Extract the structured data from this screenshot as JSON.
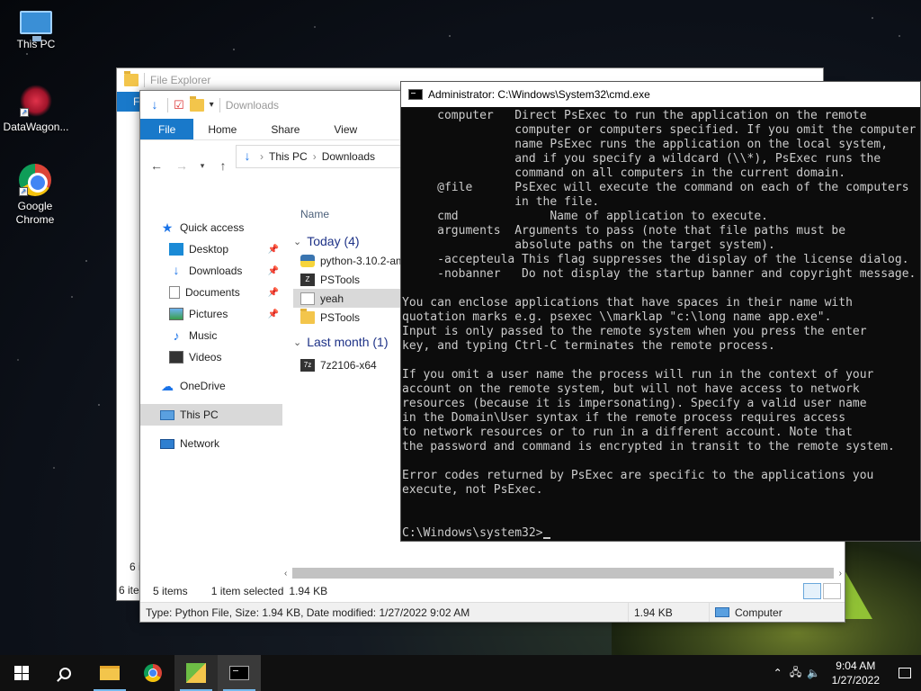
{
  "desktop": {
    "icons": [
      {
        "label": "This PC"
      },
      {
        "label": "DataWagon..."
      },
      {
        "label": "Google Chrome"
      }
    ]
  },
  "back_explorer": {
    "title": "File Explorer",
    "file_tab": "F",
    "status_a": "6 i",
    "status_b": "6 ite"
  },
  "explorer": {
    "title": "Downloads",
    "ribbon_tabs": [
      "File",
      "Home",
      "Share",
      "View"
    ],
    "breadcrumb": [
      "This PC",
      "Downloads"
    ],
    "nav_items": [
      {
        "label": "Quick access",
        "pinned": false
      },
      {
        "label": "Desktop",
        "pinned": true
      },
      {
        "label": "Downloads",
        "pinned": true
      },
      {
        "label": "Documents",
        "pinned": true
      },
      {
        "label": "Pictures",
        "pinned": true
      },
      {
        "label": "Music",
        "pinned": false
      },
      {
        "label": "Videos",
        "pinned": false
      },
      {
        "label": "OneDrive",
        "pinned": false
      },
      {
        "label": "This PC",
        "pinned": false
      },
      {
        "label": "Network",
        "pinned": false
      }
    ],
    "column_name": "Name",
    "groups": [
      {
        "label": "Today (4)",
        "files": [
          "python-3.10.2-am",
          "PSTools",
          "yeah",
          "PSTools"
        ]
      },
      {
        "label": "Last month (1)",
        "files": [
          "7z2106-x64"
        ]
      }
    ],
    "selected_file": "yeah",
    "status": {
      "items": "5 items",
      "selected": "1 item selected",
      "size": "1.94 KB"
    },
    "details": {
      "info": "Type: Python File, Size: 1.94 KB, Date modified: 1/27/2022 9:02 AM",
      "size": "1.94 KB",
      "location": "Computer"
    }
  },
  "cmd": {
    "title": "Administrator: C:\\Windows\\System32\\cmd.exe",
    "lines": [
      "     computer   Direct PsExec to run the application on the remote",
      "                computer or computers specified. If you omit the computer",
      "                name PsExec runs the application on the local system,",
      "                and if you specify a wildcard (\\\\*), PsExec runs the",
      "                command on all computers in the current domain.",
      "     @file      PsExec will execute the command on each of the computers",
      "                in the file.",
      "     cmd             Name of application to execute.",
      "     arguments  Arguments to pass (note that file paths must be",
      "                absolute paths on the target system).",
      "     -accepteula This flag suppresses the display of the license dialog.",
      "     -nobanner   Do not display the startup banner and copyright message.",
      "",
      "You can enclose applications that have spaces in their name with",
      "quotation marks e.g. psexec \\\\marklap \"c:\\long name app.exe\".",
      "Input is only passed to the remote system when you press the enter",
      "key, and typing Ctrl-C terminates the remote process.",
      "",
      "If you omit a user name the process will run in the context of your",
      "account on the remote system, but will not have access to network",
      "resources (because it is impersonating). Specify a valid user name",
      "in the Domain\\User syntax if the remote process requires access",
      "to network resources or to run in a different account. Note that",
      "the password and command is encrypted in transit to the remote system.",
      "",
      "Error codes returned by PsExec are specific to the applications you",
      "execute, not PsExec.",
      "",
      ""
    ],
    "prompt": "C:\\Windows\\system32>"
  },
  "taskbar": {
    "time": "9:04 AM",
    "date": "1/27/2022"
  }
}
